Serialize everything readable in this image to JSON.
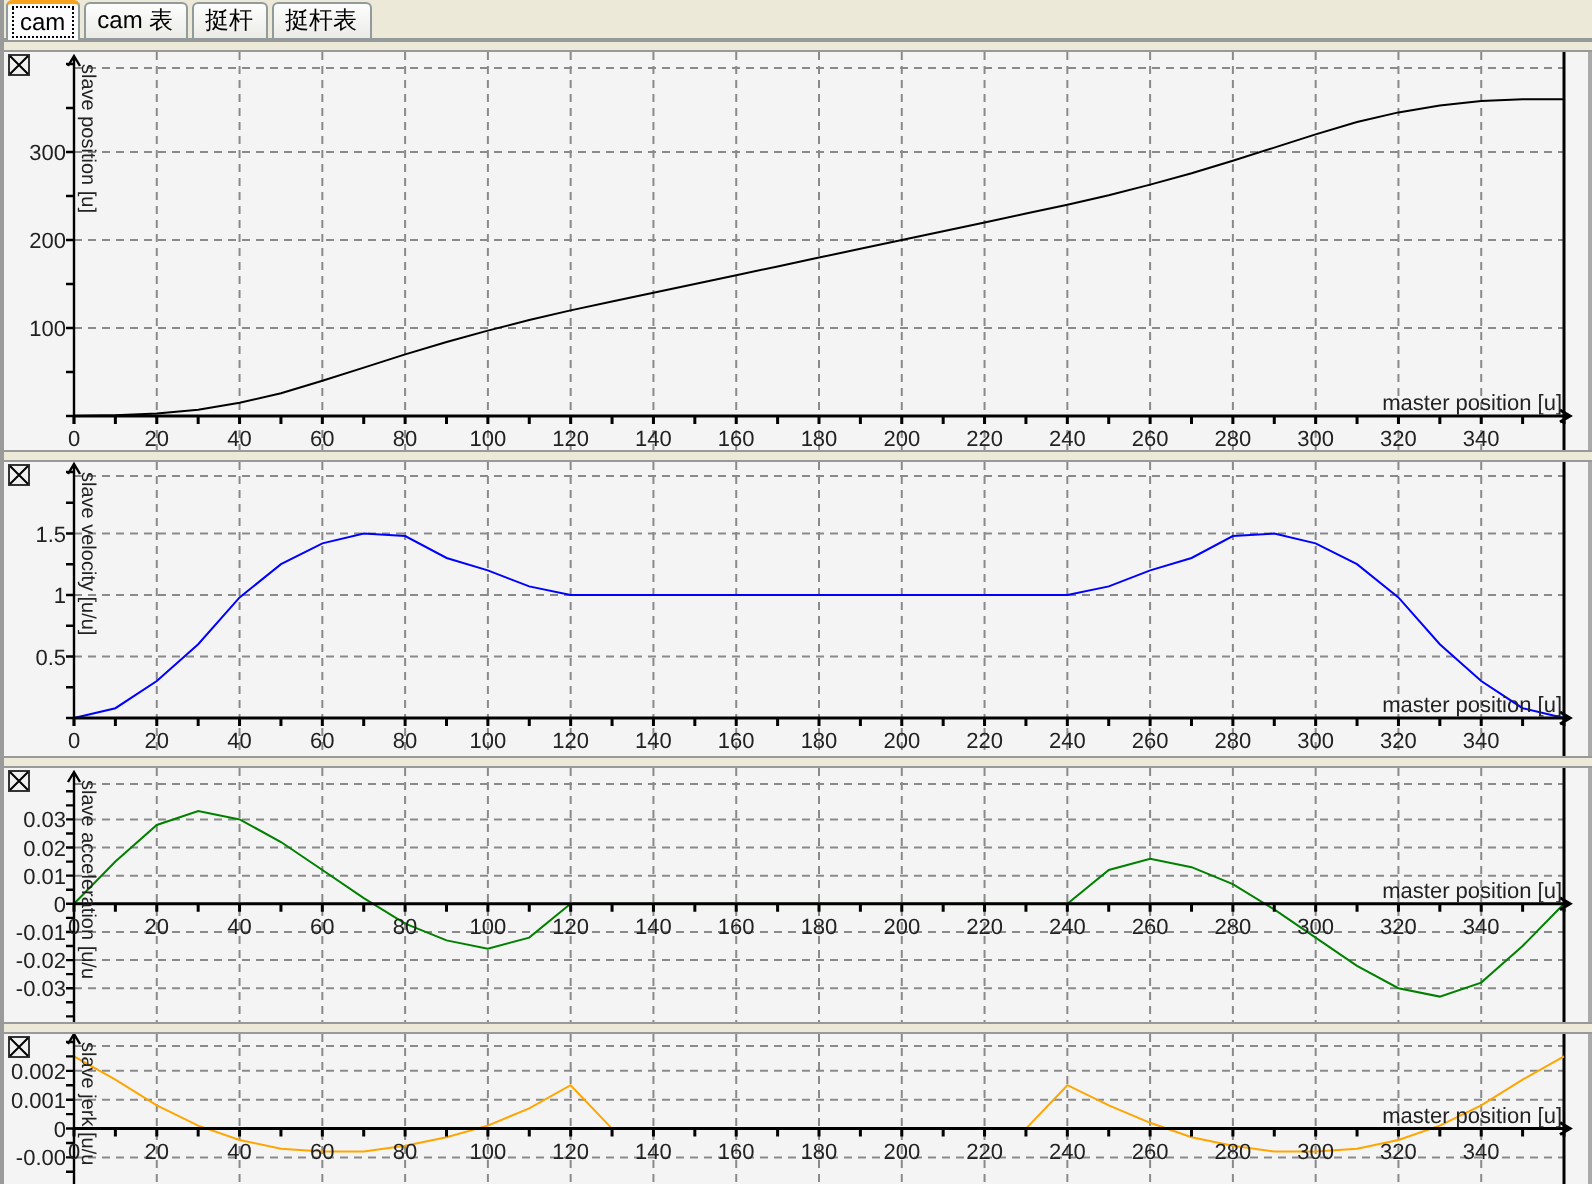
{
  "tabs": [
    {
      "label": "cam",
      "selected": true
    },
    {
      "label": "cam 表",
      "selected": false
    },
    {
      "label": "挺杆",
      "selected": false
    },
    {
      "label": "挺杆表",
      "selected": false
    }
  ],
  "charts": [
    {
      "chart_data": {
        "type": "line",
        "grid": true,
        "xlabel": "master position [u]",
        "ylabel": "slave position [u]",
        "xlim": [
          0,
          360
        ],
        "ylim": [
          0,
          400
        ],
        "xticks": [
          0,
          20,
          40,
          60,
          80,
          100,
          120,
          140,
          160,
          180,
          200,
          220,
          240,
          260,
          280,
          300,
          320,
          340
        ],
        "yticks": [
          100,
          200,
          300
        ],
        "x": [
          0,
          10,
          20,
          30,
          40,
          50,
          60,
          70,
          80,
          90,
          100,
          110,
          120,
          130,
          140,
          150,
          160,
          170,
          180,
          190,
          200,
          210,
          220,
          230,
          240,
          250,
          260,
          270,
          280,
          290,
          300,
          310,
          320,
          330,
          340,
          350,
          360
        ],
        "series": [
          {
            "color": "#000000",
            "values": [
              0,
              1,
              3,
              7,
              15,
              26,
              40,
              55,
              70,
              84,
              97,
              109,
              120,
              130,
              140,
              150,
              160,
              170,
              180,
              190,
              200,
              210,
              220,
              230,
              240,
              251,
              263,
              276,
              290,
              305,
              320,
              334,
              345,
              353,
              358,
              360,
              360
            ]
          }
        ]
      }
    },
    {
      "chart_data": {
        "type": "line",
        "grid": true,
        "xlabel": "master position [u]",
        "ylabel": "slave velocity [u/u]",
        "xlim": [
          0,
          360
        ],
        "ylim": [
          0,
          2
        ],
        "xticks": [
          0,
          20,
          40,
          60,
          80,
          100,
          120,
          140,
          160,
          180,
          200,
          220,
          240,
          260,
          280,
          300,
          320,
          340
        ],
        "yticks": [
          0.5,
          1,
          1.5
        ],
        "x": [
          0,
          10,
          20,
          30,
          40,
          50,
          60,
          70,
          80,
          90,
          100,
          110,
          120,
          130,
          140,
          150,
          160,
          170,
          180,
          190,
          200,
          210,
          220,
          230,
          240,
          250,
          260,
          270,
          280,
          290,
          300,
          310,
          320,
          330,
          340,
          350,
          360
        ],
        "series": [
          {
            "color": "#0000ff",
            "values": [
              0,
              0.08,
              0.3,
              0.6,
              0.98,
              1.25,
              1.42,
              1.5,
              1.48,
              1.3,
              1.2,
              1.07,
              1,
              1,
              1,
              1,
              1,
              1,
              1,
              1,
              1,
              1,
              1,
              1,
              1,
              1.07,
              1.2,
              1.3,
              1.48,
              1.5,
              1.42,
              1.25,
              0.98,
              0.6,
              0.3,
              0.08,
              0
            ]
          }
        ]
      }
    },
    {
      "chart_data": {
        "type": "line",
        "grid": true,
        "xlabel": "master position [u]",
        "ylabel": "slave acceleration [u/u",
        "xlim": [
          0,
          360
        ],
        "ylim": [
          -0.042,
          0.044
        ],
        "xticks": [
          0,
          20,
          40,
          60,
          80,
          100,
          120,
          140,
          160,
          180,
          200,
          220,
          240,
          260,
          280,
          300,
          320,
          340
        ],
        "yticks": [
          0.03,
          0.02,
          0.01,
          0,
          -0.01,
          -0.02,
          -0.03
        ],
        "x": [
          0,
          10,
          20,
          30,
          40,
          50,
          60,
          70,
          80,
          90,
          100,
          110,
          120,
          130,
          140,
          150,
          160,
          170,
          180,
          190,
          200,
          210,
          220,
          230,
          240,
          250,
          260,
          270,
          280,
          290,
          300,
          310,
          320,
          330,
          340,
          350,
          360
        ],
        "series": [
          {
            "color": "#008000",
            "values": [
              0,
              0.015,
              0.028,
              0.033,
              0.03,
              0.022,
              0.012,
              0.002,
              -0.007,
              -0.013,
              -0.016,
              -0.012,
              0,
              0,
              0,
              0,
              0,
              0,
              0,
              0,
              0,
              0,
              0,
              0,
              0,
              0.012,
              0.016,
              0.013,
              0.007,
              -0.002,
              -0.012,
              -0.022,
              -0.03,
              -0.033,
              -0.028,
              -0.015,
              0
            ]
          }
        ]
      }
    },
    {
      "chart_data": {
        "type": "line",
        "grid": true,
        "xlabel": "master position [u]",
        "ylabel": "slave jerk [u/u",
        "xlim": [
          0,
          360
        ],
        "ylim": [
          -0.0022,
          0.003
        ],
        "xticks": [
          0,
          20,
          40,
          60,
          80,
          100,
          120,
          140,
          160,
          180,
          200,
          220,
          240,
          260,
          280,
          300,
          320,
          340
        ],
        "yticks": [
          0.002,
          0.001,
          0,
          {
            "value": -0.001,
            "label": "-0.00"
          }
        ],
        "x": [
          0,
          10,
          20,
          30,
          40,
          50,
          60,
          70,
          80,
          90,
          100,
          110,
          120,
          130,
          140,
          150,
          160,
          170,
          180,
          190,
          200,
          210,
          220,
          230,
          240,
          250,
          260,
          270,
          280,
          290,
          300,
          310,
          320,
          330,
          340,
          350,
          360
        ],
        "series": [
          {
            "color": "#ffa500",
            "values": [
              0.0025,
              0.0017,
              0.0008,
              0.0001,
              -0.0004,
              -0.0007,
              -0.0008,
              -0.0008,
              -0.0006,
              -0.0003,
              0.0001,
              0.0007,
              0.0015,
              0,
              0,
              0,
              0,
              0,
              0,
              0,
              0,
              0,
              0,
              0,
              0.0015,
              0.0008,
              0.0002,
              -0.0003,
              -0.0006,
              -0.0008,
              -0.0008,
              -0.0007,
              -0.0004,
              0.0001,
              0.0008,
              0.0017,
              0.0025
            ]
          }
        ]
      }
    }
  ]
}
